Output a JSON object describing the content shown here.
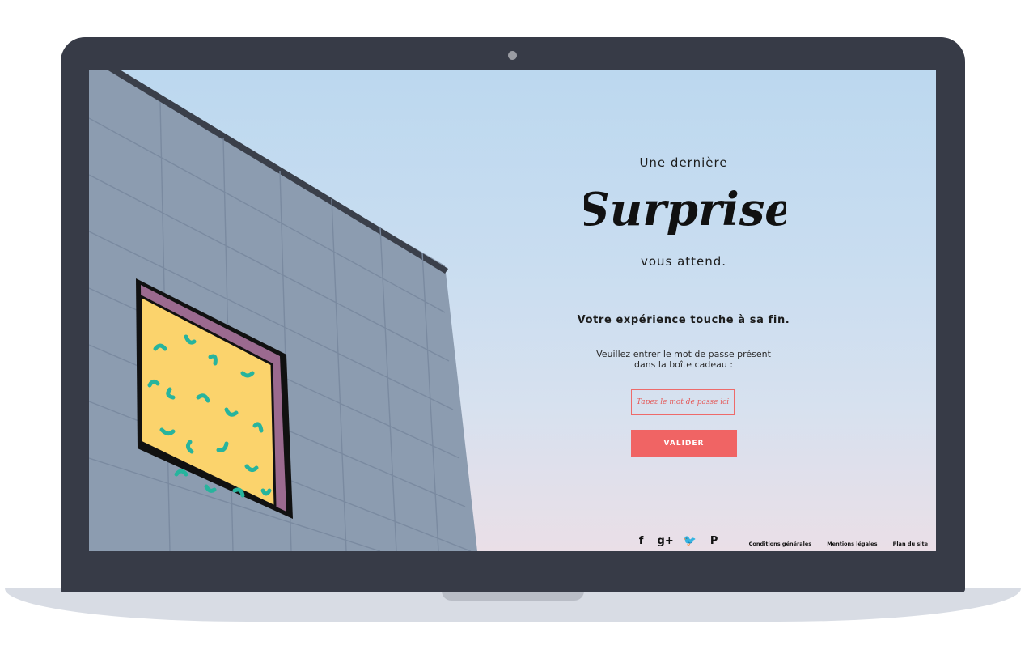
{
  "hero": {
    "line1": "Une dernière",
    "script_word": "Surprise",
    "line2": "vous attend.",
    "ending": "Votre expérience touche à sa fin.",
    "instruction": "Veuillez entrer le mot de passe présent dans la boîte cadeau :"
  },
  "form": {
    "password_placeholder": "Tapez le mot de passe ici",
    "password_value": "",
    "submit_label": "VALIDER"
  },
  "footer": {
    "social": [
      {
        "icon": "facebook-icon",
        "glyph": "f"
      },
      {
        "icon": "google-plus-icon",
        "glyph": "g+"
      },
      {
        "icon": "twitter-icon",
        "glyph": "🐦"
      },
      {
        "icon": "pinterest-icon",
        "glyph": "P"
      }
    ],
    "links": [
      "Conditions générales",
      "Mentions légales",
      "Plan du site"
    ]
  },
  "colors": {
    "accent": "#f06464",
    "frame": "#373b47",
    "window_yellow": "#fbd36c",
    "squiggle_green": "#27b49d",
    "window_purple": "#9b6a8f"
  }
}
